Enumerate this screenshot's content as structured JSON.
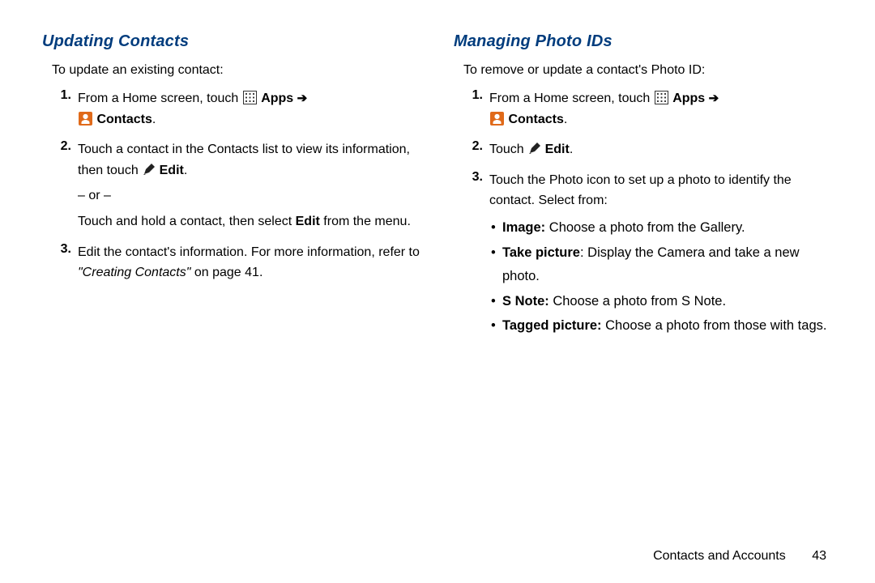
{
  "left": {
    "heading": "Updating Contacts",
    "intro": "To update an existing contact:",
    "steps": [
      {
        "num": "1.",
        "lead": "From a Home screen, touch ",
        "apps_label": "Apps",
        "contacts_label": "Contacts",
        "tail": "."
      },
      {
        "num": "2.",
        "l1a": "Touch a contact in the Contacts list to view its information, then touch ",
        "l1edit": "Edit",
        "l1b": ".",
        "or": "– or –",
        "l2a": "Touch and hold a contact, then select ",
        "l2b": "Edit",
        "l2c": " from the menu."
      },
      {
        "num": "3.",
        "a": "Edit the contact's information. For more information, refer to ",
        "ref": "\"Creating Contacts\"",
        "b": "  on page 41."
      }
    ]
  },
  "right": {
    "heading": "Managing Photo IDs",
    "intro": "To remove or update a contact's Photo ID:",
    "steps": [
      {
        "num": "1.",
        "lead": "From a Home screen, touch ",
        "apps_label": "Apps",
        "contacts_label": "Contacts",
        "tail": "."
      },
      {
        "num": "2.",
        "a": "Touch ",
        "edit": "Edit",
        "b": "."
      },
      {
        "num": "3.",
        "a": "Touch the Photo icon to set up a photo to identify the contact. Select from:",
        "sub": [
          {
            "b": "Image:",
            "t": " Choose a photo from the Gallery."
          },
          {
            "b": "Take picture",
            "t": ": Display the Camera and take a new photo."
          },
          {
            "b": "S Note:",
            "t": " Choose a photo from S Note."
          },
          {
            "b": "Tagged picture:",
            "t": " Choose a photo from those with tags."
          }
        ]
      }
    ]
  },
  "footer": {
    "section": "Contacts and Accounts",
    "page": "43"
  }
}
